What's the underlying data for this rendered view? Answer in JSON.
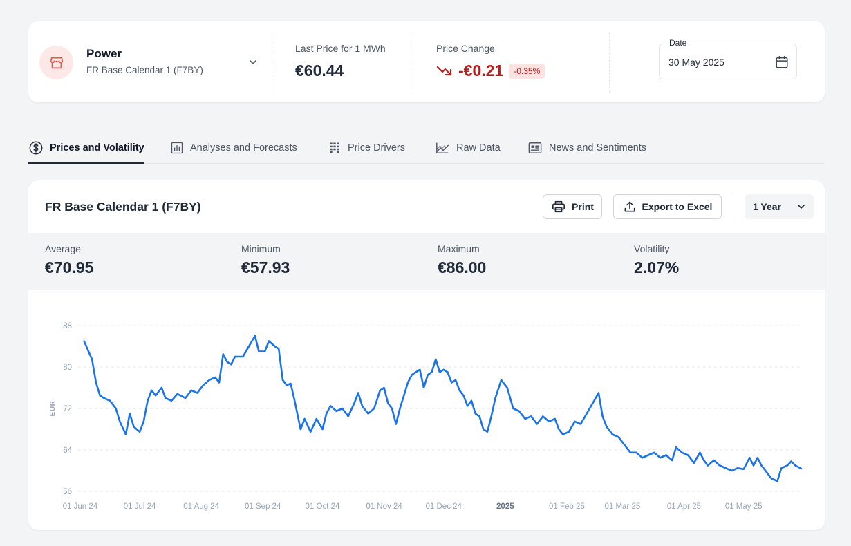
{
  "header": {
    "asset_name": "Power",
    "asset_contract": "FR Base Calendar 1 (F7BY)",
    "last_price_label": "Last Price for 1 MWh",
    "last_price_value": "€60.44",
    "price_change_label": "Price Change",
    "price_change_value": "-€0.21",
    "price_change_pct": "-0.35%",
    "date_label": "Date",
    "date_value": "30 May 2025",
    "accent_red": "#b91c1c"
  },
  "tabs": [
    {
      "label": "Prices and Volatility",
      "icon": "dollar-circle-icon",
      "active": true
    },
    {
      "label": "Analyses and Forecasts",
      "icon": "bar-chart-icon",
      "active": false
    },
    {
      "label": "Price Drivers",
      "icon": "grid-bars-icon",
      "active": false
    },
    {
      "label": "Raw Data",
      "icon": "trend-chart-icon",
      "active": false
    },
    {
      "label": "News and Sentiments",
      "icon": "newspaper-icon",
      "active": false
    }
  ],
  "card": {
    "title": "FR Base Calendar 1 (F7BY)",
    "print_label": "Print",
    "export_label": "Export to Excel",
    "range_value": "1 Year"
  },
  "stats": [
    {
      "label": "Average",
      "value": "€70.95"
    },
    {
      "label": "Minimum",
      "value": "€57.93"
    },
    {
      "label": "Maximum",
      "value": "€86.00"
    },
    {
      "label": "Volatility",
      "value": "2.07%"
    }
  ],
  "chart_data": {
    "type": "line",
    "title": "",
    "xlabel": "",
    "ylabel": "EUR",
    "ylim": [
      56,
      88
    ],
    "yticks": [
      56,
      64,
      72,
      80,
      88
    ],
    "xlim": [
      "2024-05-31",
      "2025-05-30"
    ],
    "grid": true,
    "line_color": "#1a73e8",
    "xticks": [
      {
        "date": "2024-06-01",
        "label": "01 Jun 24",
        "bold": false
      },
      {
        "date": "2024-07-01",
        "label": "01 Jul 24",
        "bold": false
      },
      {
        "date": "2024-08-01",
        "label": "01 Aug 24",
        "bold": false
      },
      {
        "date": "2024-09-01",
        "label": "01 Sep 24",
        "bold": false
      },
      {
        "date": "2024-10-01",
        "label": "01 Oct 24",
        "bold": false
      },
      {
        "date": "2024-11-01",
        "label": "01 Nov 24",
        "bold": false
      },
      {
        "date": "2024-12-01",
        "label": "01 Dec 24",
        "bold": false
      },
      {
        "date": "2025-01-01",
        "label": "2025",
        "bold": true
      },
      {
        "date": "2025-02-01",
        "label": "01 Feb 25",
        "bold": false
      },
      {
        "date": "2025-03-01",
        "label": "01 Mar 25",
        "bold": false
      },
      {
        "date": "2025-04-01",
        "label": "01 Apr 25",
        "bold": false
      },
      {
        "date": "2025-05-01",
        "label": "01 May 25",
        "bold": false
      }
    ],
    "series": [
      {
        "name": "",
        "points": [
          [
            "2024-06-03",
            85.0
          ],
          [
            "2024-06-05",
            83.2
          ],
          [
            "2024-06-07",
            81.5
          ],
          [
            "2024-06-09",
            77.0
          ],
          [
            "2024-06-11",
            74.5
          ],
          [
            "2024-06-13",
            74.0
          ],
          [
            "2024-06-16",
            73.5
          ],
          [
            "2024-06-19",
            72.0
          ],
          [
            "2024-06-21",
            69.5
          ],
          [
            "2024-06-24",
            67.0
          ],
          [
            "2024-06-26",
            71.0
          ],
          [
            "2024-06-28",
            68.5
          ],
          [
            "2024-07-01",
            67.5
          ],
          [
            "2024-07-03",
            69.5
          ],
          [
            "2024-07-05",
            73.5
          ],
          [
            "2024-07-07",
            75.5
          ],
          [
            "2024-07-09",
            74.5
          ],
          [
            "2024-07-12",
            76.0
          ],
          [
            "2024-07-14",
            74.0
          ],
          [
            "2024-07-17",
            73.5
          ],
          [
            "2024-07-20",
            74.8
          ],
          [
            "2024-07-24",
            74.0
          ],
          [
            "2024-07-27",
            75.5
          ],
          [
            "2024-07-30",
            75.0
          ],
          [
            "2024-08-02",
            76.5
          ],
          [
            "2024-08-05",
            77.5
          ],
          [
            "2024-08-08",
            78.0
          ],
          [
            "2024-08-10",
            77.0
          ],
          [
            "2024-08-12",
            82.5
          ],
          [
            "2024-08-14",
            81.0
          ],
          [
            "2024-08-16",
            80.5
          ],
          [
            "2024-08-18",
            82.0
          ],
          [
            "2024-08-22",
            82.0
          ],
          [
            "2024-08-25",
            84.0
          ],
          [
            "2024-08-28",
            86.0
          ],
          [
            "2024-08-30",
            83.0
          ],
          [
            "2024-09-02",
            83.0
          ],
          [
            "2024-09-04",
            85.0
          ],
          [
            "2024-09-07",
            84.0
          ],
          [
            "2024-09-09",
            83.5
          ],
          [
            "2024-09-11",
            77.5
          ],
          [
            "2024-09-13",
            76.5
          ],
          [
            "2024-09-15",
            76.8
          ],
          [
            "2024-09-17",
            73.5
          ],
          [
            "2024-09-20",
            68.0
          ],
          [
            "2024-09-22",
            70.0
          ],
          [
            "2024-09-25",
            67.5
          ],
          [
            "2024-09-28",
            70.0
          ],
          [
            "2024-10-01",
            68.0
          ],
          [
            "2024-10-03",
            71.0
          ],
          [
            "2024-10-05",
            72.5
          ],
          [
            "2024-10-08",
            71.5
          ],
          [
            "2024-10-11",
            72.0
          ],
          [
            "2024-10-14",
            70.5
          ],
          [
            "2024-10-17",
            73.0
          ],
          [
            "2024-10-19",
            75.0
          ],
          [
            "2024-10-21",
            72.5
          ],
          [
            "2024-10-24",
            71.0
          ],
          [
            "2024-10-27",
            72.0
          ],
          [
            "2024-10-30",
            75.5
          ],
          [
            "2024-11-01",
            76.0
          ],
          [
            "2024-11-03",
            73.0
          ],
          [
            "2024-11-05",
            72.0
          ],
          [
            "2024-11-07",
            69.0
          ],
          [
            "2024-11-09",
            72.0
          ],
          [
            "2024-11-11",
            74.5
          ],
          [
            "2024-11-13",
            77.0
          ],
          [
            "2024-11-15",
            78.5
          ],
          [
            "2024-11-17",
            79.0
          ],
          [
            "2024-11-19",
            79.5
          ],
          [
            "2024-11-21",
            76.0
          ],
          [
            "2024-11-23",
            78.5
          ],
          [
            "2024-11-25",
            79.0
          ],
          [
            "2024-11-27",
            81.5
          ],
          [
            "2024-11-29",
            79.0
          ],
          [
            "2024-12-01",
            79.5
          ],
          [
            "2024-12-03",
            79.0
          ],
          [
            "2024-12-05",
            77.0
          ],
          [
            "2024-12-07",
            77.5
          ],
          [
            "2024-12-09",
            75.5
          ],
          [
            "2024-12-11",
            74.5
          ],
          [
            "2024-12-13",
            72.5
          ],
          [
            "2024-12-15",
            73.5
          ],
          [
            "2024-12-17",
            71.0
          ],
          [
            "2024-12-19",
            70.5
          ],
          [
            "2024-12-21",
            68.0
          ],
          [
            "2024-12-23",
            67.5
          ],
          [
            "2024-12-25",
            70.5
          ],
          [
            "2024-12-27",
            74.0
          ],
          [
            "2024-12-30",
            77.5
          ],
          [
            "2025-01-02",
            76.0
          ],
          [
            "2025-01-05",
            72.0
          ],
          [
            "2025-01-08",
            71.5
          ],
          [
            "2025-01-11",
            70.0
          ],
          [
            "2025-01-14",
            70.5
          ],
          [
            "2025-01-17",
            69.0
          ],
          [
            "2025-01-20",
            70.5
          ],
          [
            "2025-01-23",
            69.5
          ],
          [
            "2025-01-26",
            70.0
          ],
          [
            "2025-01-28",
            68.0
          ],
          [
            "2025-01-30",
            67.0
          ],
          [
            "2025-02-02",
            67.5
          ],
          [
            "2025-02-05",
            69.5
          ],
          [
            "2025-02-08",
            69.0
          ],
          [
            "2025-02-11",
            71.0
          ],
          [
            "2025-02-14",
            73.0
          ],
          [
            "2025-02-17",
            75.0
          ],
          [
            "2025-02-19",
            70.5
          ],
          [
            "2025-02-21",
            68.5
          ],
          [
            "2025-02-24",
            67.0
          ],
          [
            "2025-02-27",
            66.5
          ],
          [
            "2025-03-02",
            65.0
          ],
          [
            "2025-03-05",
            63.5
          ],
          [
            "2025-03-08",
            63.5
          ],
          [
            "2025-03-11",
            62.5
          ],
          [
            "2025-03-14",
            63.0
          ],
          [
            "2025-03-17",
            63.5
          ],
          [
            "2025-03-20",
            62.5
          ],
          [
            "2025-03-23",
            63.0
          ],
          [
            "2025-03-26",
            62.0
          ],
          [
            "2025-03-28",
            64.5
          ],
          [
            "2025-03-31",
            63.5
          ],
          [
            "2025-04-03",
            63.0
          ],
          [
            "2025-04-06",
            61.5
          ],
          [
            "2025-04-09",
            63.5
          ],
          [
            "2025-04-11",
            62.0
          ],
          [
            "2025-04-13",
            61.0
          ],
          [
            "2025-04-16",
            62.0
          ],
          [
            "2025-04-19",
            61.0
          ],
          [
            "2025-04-22",
            60.5
          ],
          [
            "2025-04-25",
            60.0
          ],
          [
            "2025-04-28",
            60.5
          ],
          [
            "2025-05-01",
            60.3
          ],
          [
            "2025-05-04",
            62.5
          ],
          [
            "2025-05-06",
            61.0
          ],
          [
            "2025-05-08",
            62.5
          ],
          [
            "2025-05-10",
            61.0
          ],
          [
            "2025-05-12",
            60.0
          ],
          [
            "2025-05-15",
            58.5
          ],
          [
            "2025-05-18",
            58.0
          ],
          [
            "2025-05-20",
            60.5
          ],
          [
            "2025-05-23",
            61.0
          ],
          [
            "2025-05-25",
            61.8
          ],
          [
            "2025-05-27",
            61.0
          ],
          [
            "2025-05-30",
            60.4
          ]
        ]
      }
    ]
  }
}
